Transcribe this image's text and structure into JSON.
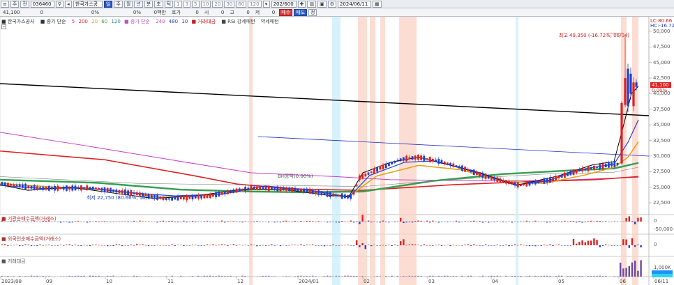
{
  "toolbar": {
    "mode": "주",
    "market": "전",
    "code": "036460",
    "name": "한국가스공",
    "period_buttons": [
      "주",
      "월",
      "년",
      "분",
      "초",
      "틱"
    ],
    "interval_buttons": [
      "1",
      "3",
      "5",
      "10",
      "20",
      "30",
      "60",
      "120"
    ],
    "count": "202/600",
    "date": "2024/06/11"
  },
  "quote": {
    "price": "41,100",
    "change": "0",
    "pct_label": "0%",
    "vol_label": "0%",
    "unit": "0백만",
    "hoga_label": "호가",
    "open_value": "0",
    "open_label": "시",
    "open_value2": "0",
    "high_label": "고",
    "high_value": "0",
    "low_label": "저",
    "low_value": "0",
    "buy": "매수",
    "sell": "매도",
    "jeong": "정"
  },
  "legend": {
    "name": "한국가스공사",
    "ma_label": "종가 단순",
    "ma_values": [
      "5",
      "200",
      "20",
      "60",
      "120"
    ],
    "ma2_label": "종가 단순",
    "ma2_values": [
      "240",
      "480",
      "10"
    ],
    "vol_label": "거래대금",
    "rsi_label": "RSI 강세패턴",
    "rsi2_label": "약세패턴"
  },
  "annotations": {
    "high": "최고 49,350 (-16.72%, 06/04)",
    "low": "최저 22,750 (80.66%, 10/24)",
    "mid": "BH등락(0.00%)",
    "lc": "LC:80.66",
    "hc": "HC:-16.72"
  },
  "price_axis": [
    "50,000",
    "47,500",
    "45,000",
    "42,500",
    "40,000",
    "37,500",
    "35,000",
    "32,500",
    "30,000",
    "27,500",
    "25,000",
    "22,500"
  ],
  "current_price_tag": "41,100",
  "current_pct_tag": "0.00%",
  "panels": {
    "inst": "기관순매수금액(거래소)",
    "foreign": "외국인순매수금액(거래소)",
    "volume": "거래대금",
    "inst_axis": [
      "0",
      "-50,000"
    ],
    "foreign_axis": [
      "0"
    ],
    "volume_axis": "1,000K"
  },
  "x_axis": [
    "2023/08",
    "09",
    "10",
    "11",
    "12",
    "2024/01",
    "02",
    "03",
    "04",
    "05",
    "06",
    "06/11"
  ],
  "colors": {
    "up": "#e02020",
    "down": "#2040d0",
    "highlight_red": "#fbd2c6",
    "highlight_blue": "#c9eef9"
  }
}
